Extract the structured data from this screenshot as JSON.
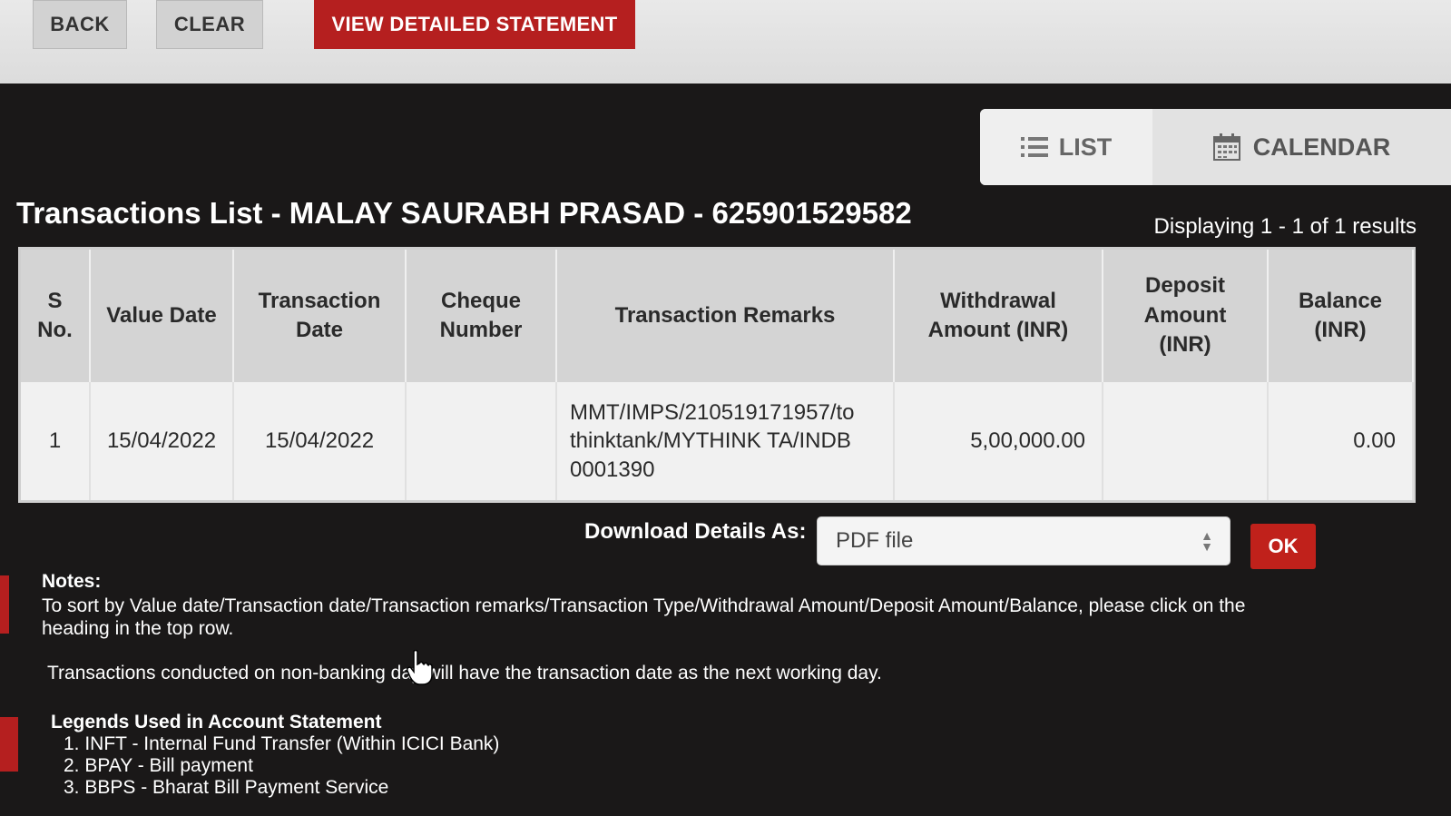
{
  "toolbar": {
    "back_label": "BACK",
    "clear_label": "CLEAR",
    "statement_label": "VIEW DETAILED STATEMENT"
  },
  "view_toggle": {
    "list_label": "LIST",
    "calendar_label": "CALENDAR",
    "list_icon": "list-icon",
    "calendar_icon": "calendar-icon"
  },
  "title": "Transactions List - MALAY SAURABH PRASAD - 625901529582",
  "results_text": "Displaying 1 - 1 of 1 results",
  "table": {
    "headers": {
      "s_no_1": "S",
      "s_no_2": "No.",
      "value_date": "Value Date",
      "txn_date_1": "Transaction",
      "txn_date_2": "Date",
      "cheque_1": "Cheque",
      "cheque_2": "Number",
      "remarks": "Transaction Remarks",
      "withdrawal_1": "Withdrawal",
      "withdrawal_2": "Amount (INR)",
      "deposit_1": "Deposit",
      "deposit_2": "Amount",
      "deposit_3": "(INR)",
      "balance_1": "Balance",
      "balance_2": "(INR)"
    },
    "rows": [
      {
        "s_no": "1",
        "value_date": "15/04/2022",
        "transaction_date": "15/04/2022",
        "cheque_number": "",
        "remarks_1": "MMT/IMPS/210519171957/to",
        "remarks_2": "thinktank/MYTHINK TA/INDB",
        "remarks_3": "0001390",
        "withdrawal": "5,00,000.00",
        "deposit": "",
        "balance": "0.00"
      }
    ]
  },
  "download": {
    "label": "Download Details As:",
    "selected": "PDF file",
    "ok_label": "OK"
  },
  "notes": {
    "heading": "Notes:",
    "sort_note_1": "To sort by Value date/Transaction date/Transaction remarks/Transaction Type/Withdrawal Amount/Deposit Amount/Balance, please click on the",
    "sort_note_2": "heading in the top row.",
    "non_banking_note": "Transactions conducted on non-banking day will have the transaction date as the next working day."
  },
  "legends": {
    "title": "Legends Used in Account Statement",
    "items": [
      "1. INFT - Internal Fund Transfer (Within ICICI Bank)",
      "2. BPAY - Bill payment",
      "3. BBPS - Bharat Bill Payment Service"
    ]
  }
}
